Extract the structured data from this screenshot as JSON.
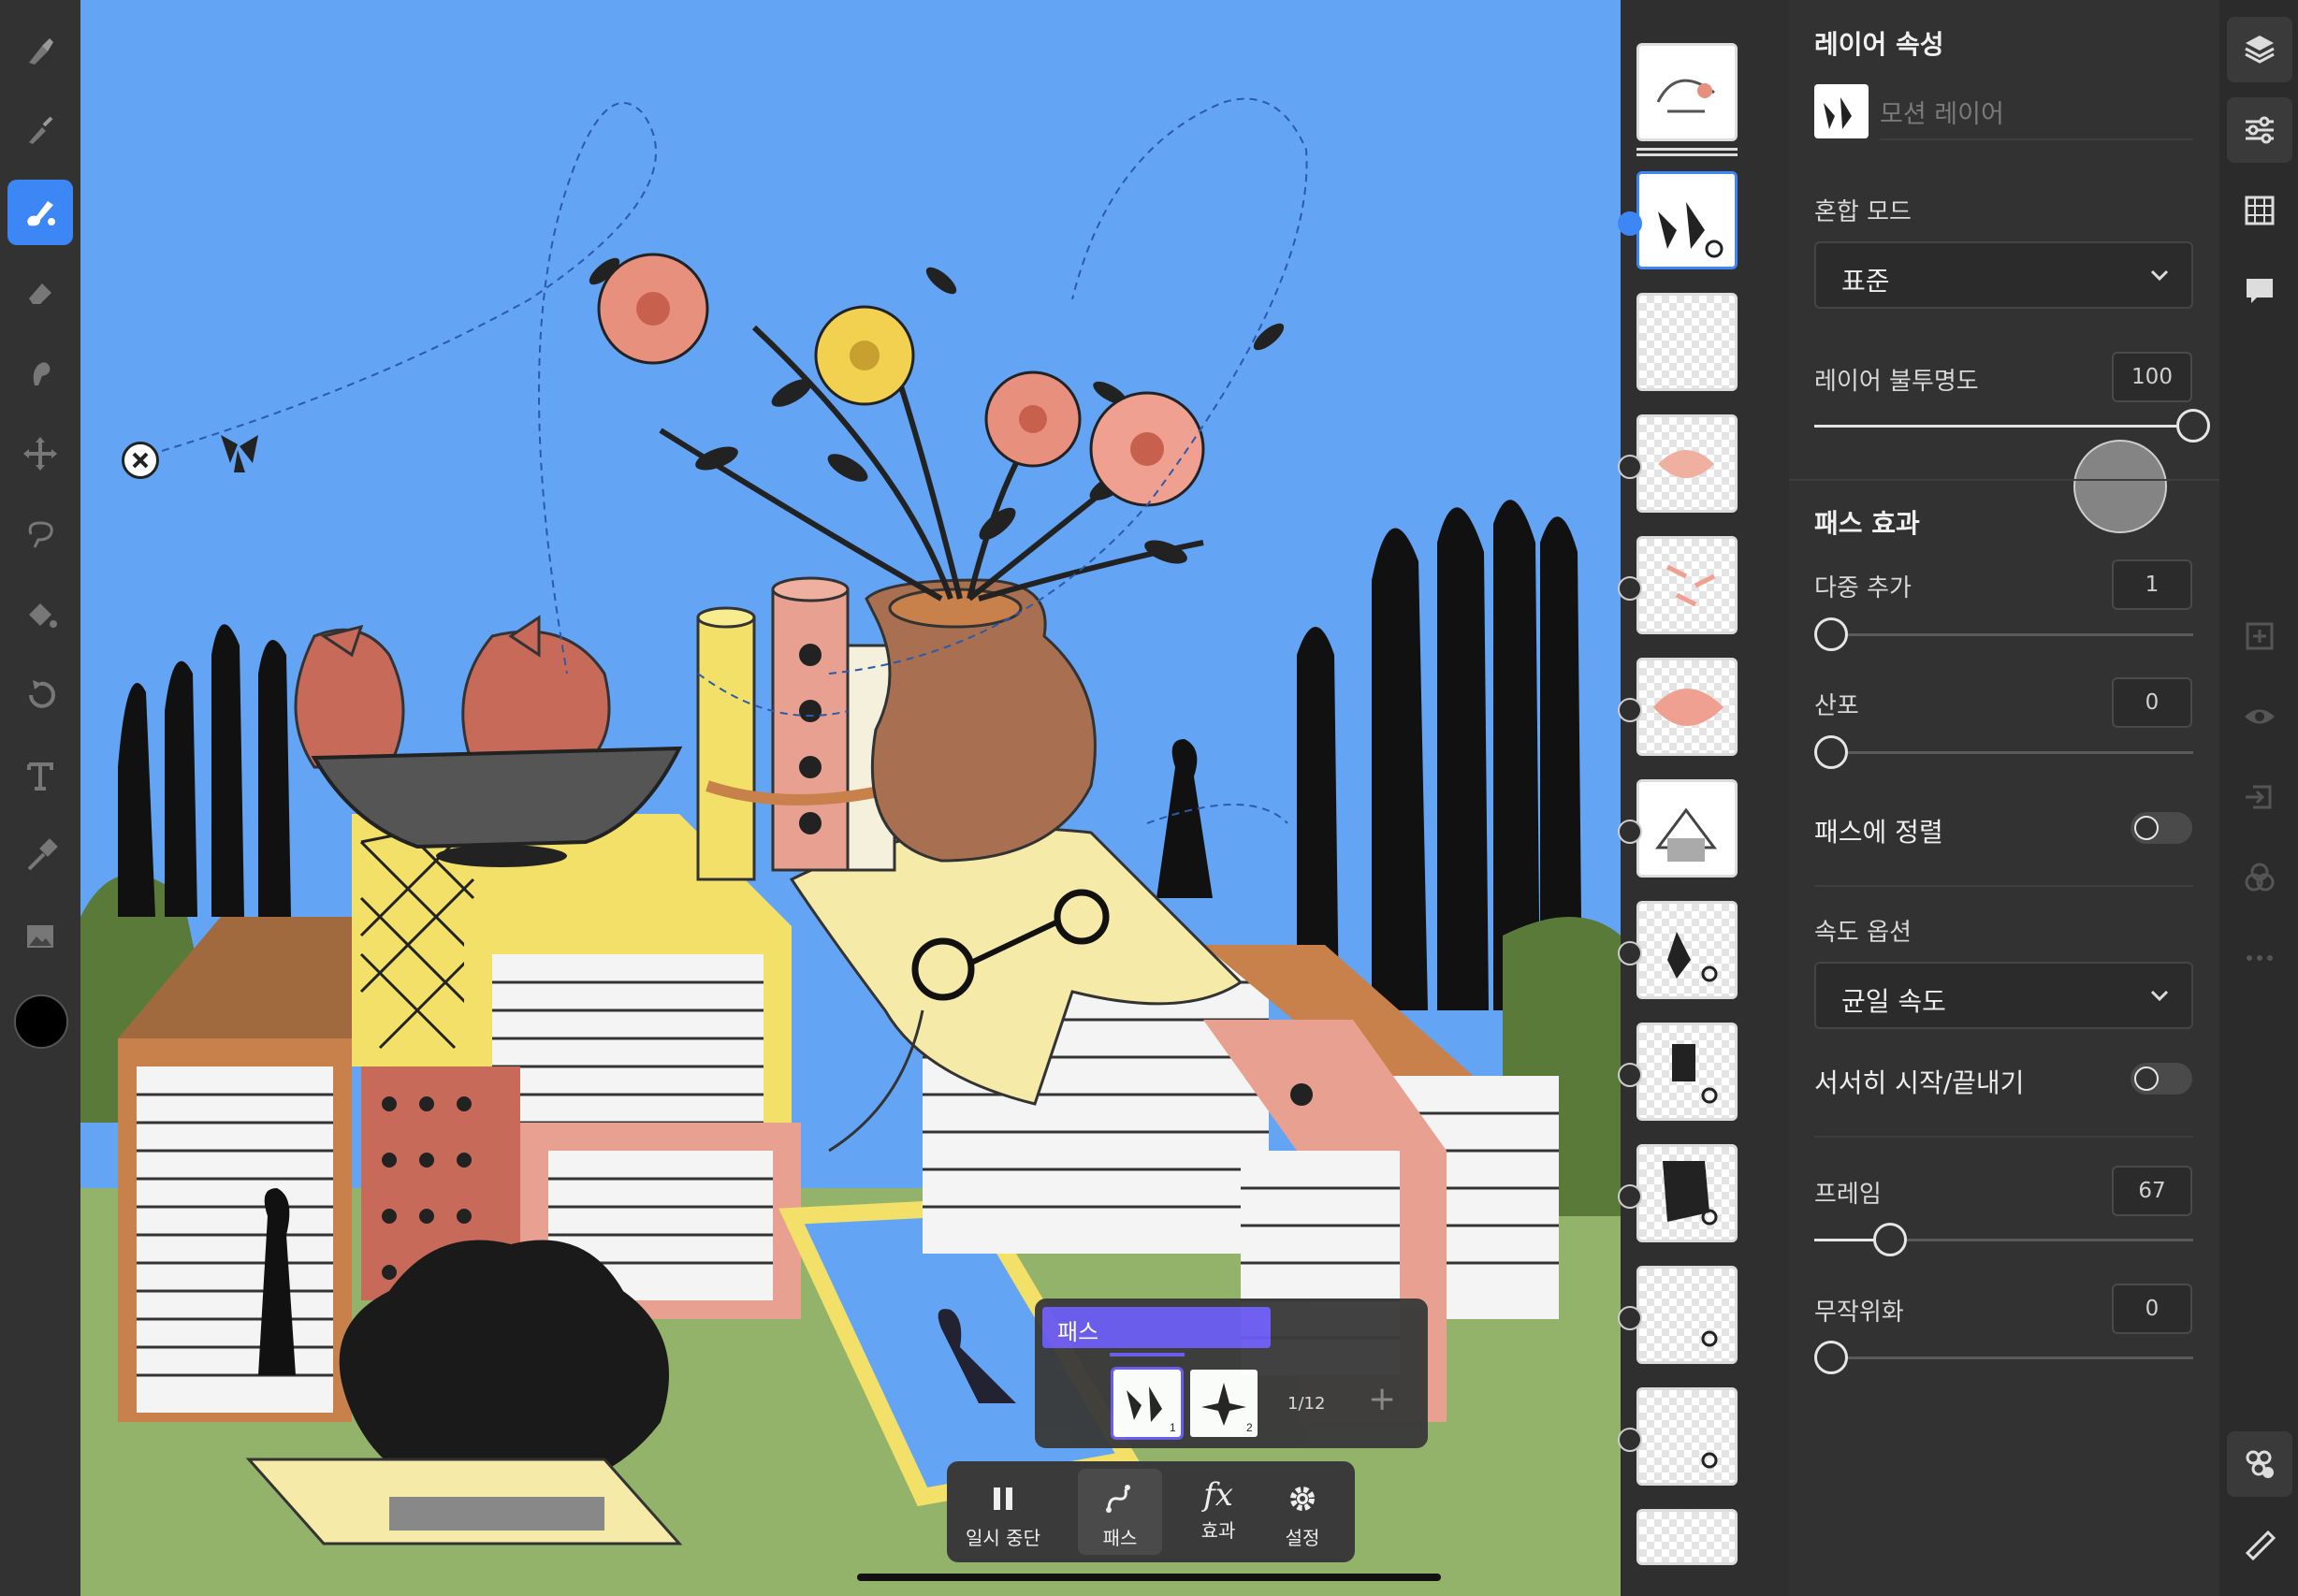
{
  "left_toolbar": {
    "tools": [
      "pixel-brush-icon",
      "vector-brush-icon",
      "animation-brush-icon",
      "eraser-icon",
      "smudge-icon",
      "transform-icon",
      "lasso-icon",
      "fill-icon",
      "undo-icon",
      "text-icon",
      "eyedropper-icon",
      "image-icon"
    ],
    "active_tool": "animation-brush-icon",
    "current_color": "#000000"
  },
  "properties": {
    "title": "레이어 속성",
    "layer_name_placeholder": "모션 레이어",
    "blend_mode_label": "혼합 모드",
    "blend_mode_value": "표준",
    "opacity_label": "레이어 불투명도",
    "opacity_value": "100",
    "path_effects_title": "패스 효과",
    "multi_add_label": "다중 추가",
    "multi_add_value": "1",
    "scatter_label": "산포",
    "scatter_value": "0",
    "align_to_path_label": "패스에 정렬",
    "speed_options_label": "속도 옵션",
    "speed_value": "균일 속도",
    "ease_label": "서서히 시작/끝내기",
    "frame_label": "프레임",
    "frame_value": "67",
    "randomize_label": "무작위화",
    "randomize_value": "0"
  },
  "right_rail": [
    "layers-icon",
    "properties-icon",
    "grid-icon",
    "comment-icon",
    "add-layer-icon",
    "visibility-icon",
    "merge-icon",
    "blend-icon",
    "more-icon",
    "motion-settings-icon",
    "ruler-icon"
  ],
  "timeline": {
    "track_label": "패스",
    "frame_counter": "1/12",
    "frames": [
      {
        "num": "1"
      },
      {
        "num": "2"
      }
    ],
    "add_label": "+"
  },
  "bottom_bar": {
    "pause_label": "일시 중단",
    "path_label": "패스",
    "effects_label": "효과",
    "effects_glyph": "fx",
    "settings_label": "설정"
  },
  "colors": {
    "accent": "#3d86f5",
    "sky": "#64a4f5",
    "path_track": "#6a5af2"
  }
}
